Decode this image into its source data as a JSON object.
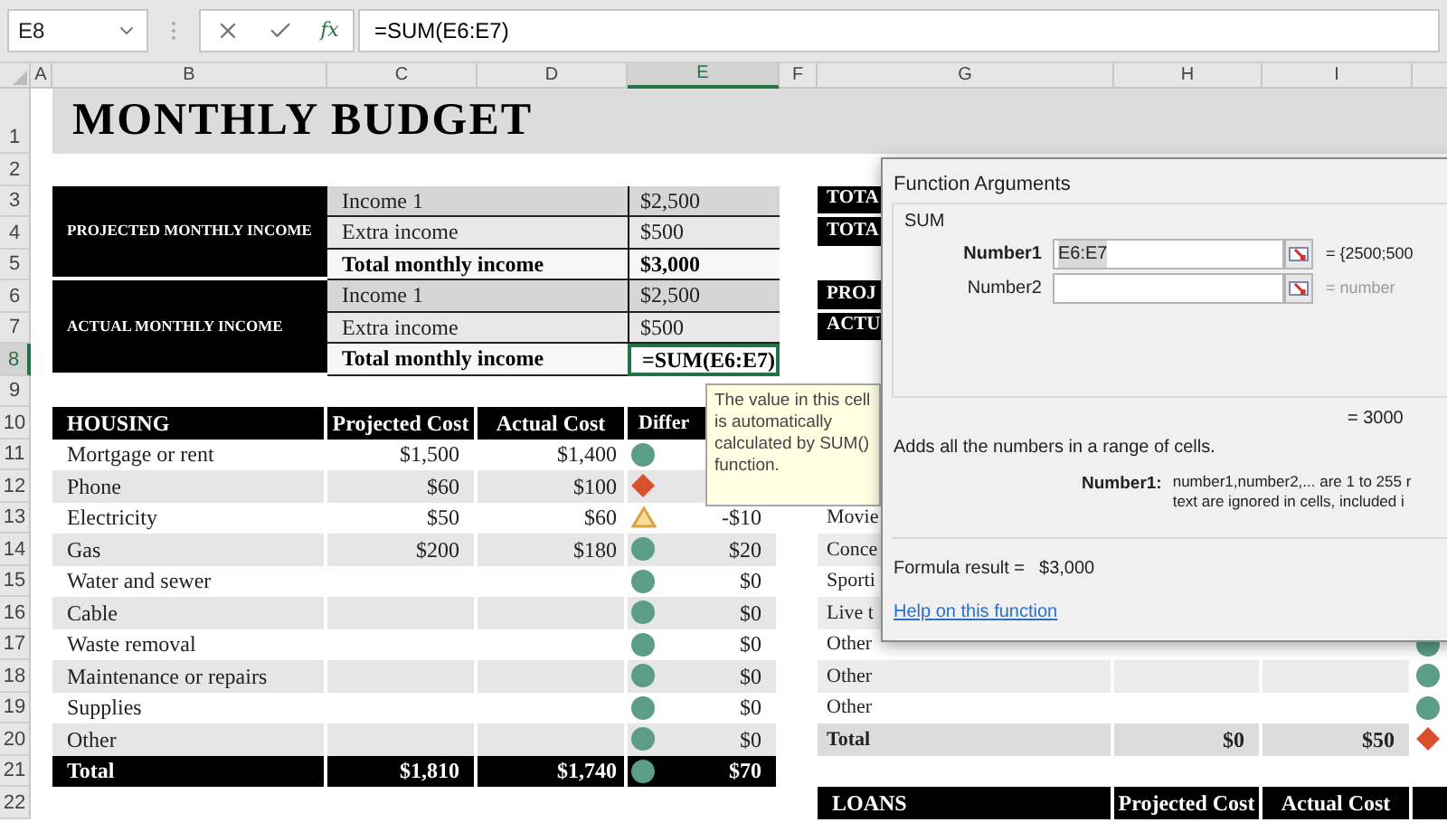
{
  "name_box": {
    "value": "E8"
  },
  "formula_bar": {
    "function_button": "fx",
    "formula": "=SUM(E6:E7)"
  },
  "columns": [
    {
      "label": "A",
      "selected": false
    },
    {
      "label": "B",
      "selected": false
    },
    {
      "label": "C",
      "selected": false
    },
    {
      "label": "D",
      "selected": false
    },
    {
      "label": "E",
      "selected": true
    },
    {
      "label": "F",
      "selected": false
    },
    {
      "label": "G",
      "selected": false
    },
    {
      "label": "H",
      "selected": false
    },
    {
      "label": "I",
      "selected": false
    }
  ],
  "row_numbers": [
    {
      "label": "1",
      "selected": false
    },
    {
      "label": "2",
      "selected": false
    },
    {
      "label": "3",
      "selected": false
    },
    {
      "label": "4",
      "selected": false
    },
    {
      "label": "5",
      "selected": false
    },
    {
      "label": "6",
      "selected": false
    },
    {
      "label": "7",
      "selected": false
    },
    {
      "label": "8",
      "selected": true
    },
    {
      "label": "9",
      "selected": false
    },
    {
      "label": "10",
      "selected": false
    },
    {
      "label": "11",
      "selected": false
    },
    {
      "label": "12",
      "selected": false
    },
    {
      "label": "13",
      "selected": false
    },
    {
      "label": "14",
      "selected": false
    },
    {
      "label": "15",
      "selected": false
    },
    {
      "label": "16",
      "selected": false
    },
    {
      "label": "17",
      "selected": false
    },
    {
      "label": "18",
      "selected": false
    },
    {
      "label": "19",
      "selected": false
    },
    {
      "label": "20",
      "selected": false
    },
    {
      "label": "21",
      "selected": false
    },
    {
      "label": "22",
      "selected": false
    }
  ],
  "title": "MONTHLY BUDGET",
  "income_sections": [
    {
      "label": "PROJECTED MONTHLY INCOME",
      "rows": [
        {
          "label": "Income 1",
          "value": "$2,500",
          "kind": "item",
          "selected": false
        },
        {
          "label": "Extra income",
          "value": "$500",
          "kind": "item",
          "selected": false
        },
        {
          "label": "Total monthly income",
          "value": "$3,000",
          "kind": "total",
          "selected": false
        }
      ]
    },
    {
      "label": "ACTUAL MONTHLY INCOME",
      "rows": [
        {
          "label": "Income 1",
          "value": "$2,500",
          "kind": "item",
          "selected": false
        },
        {
          "label": "Extra income",
          "value": "$500",
          "kind": "item",
          "selected": false
        },
        {
          "label": "Total monthly income",
          "value": "=SUM(E6:E7)",
          "kind": "total",
          "selected": true
        }
      ]
    }
  ],
  "summary_labels": [
    {
      "label": "TOTA"
    },
    {
      "label": "TOTA"
    },
    {
      "label": "PROJ"
    },
    {
      "label": "ACTU"
    }
  ],
  "housing": {
    "columns": [
      "HOUSING",
      "Projected Cost",
      "Actual Cost",
      "Differ"
    ],
    "rows": [
      {
        "label": "Mortgage or rent",
        "projected": "$1,500",
        "actual": "$1,400",
        "kind": "ok"
      },
      {
        "label": "Phone",
        "projected": "$60",
        "actual": "$100",
        "kind": "over"
      },
      {
        "label": "Electricity",
        "projected": "$50",
        "actual": "$60",
        "kind": "warning",
        "difference": "-$10"
      },
      {
        "label": "Gas",
        "projected": "$200",
        "actual": "$180",
        "kind": "ok",
        "difference": "$20"
      },
      {
        "label": "Water and sewer",
        "kind": "ok",
        "difference": "$0"
      },
      {
        "label": "Cable",
        "kind": "ok",
        "difference": "$0"
      },
      {
        "label": "Waste removal",
        "kind": "ok",
        "difference": "$0"
      },
      {
        "label": "Maintenance or repairs",
        "kind": "ok",
        "difference": "$0"
      },
      {
        "label": "Supplies",
        "kind": "ok",
        "difference": "$0"
      },
      {
        "label": "Other",
        "kind": "ok",
        "difference": "$0"
      }
    ],
    "total": {
      "label": "Total",
      "projected": "$1,810",
      "actual": "$1,740",
      "kind": "ok",
      "difference": "$70"
    }
  },
  "entertainment": {
    "rows": [
      {
        "label": "Movie"
      },
      {
        "label": "Conce"
      },
      {
        "label": "Sporti"
      },
      {
        "label": "Live t"
      },
      {
        "label": "Other",
        "kind": "ok"
      },
      {
        "label": "Other",
        "kind": "ok"
      },
      {
        "label": "Other",
        "kind": "ok"
      }
    ],
    "total": {
      "label": "Total",
      "projected": "$0",
      "actual": "$50",
      "kind": "over"
    }
  },
  "loans": {
    "columns": [
      "LOANS",
      "Projected Cost",
      "Actual Cost"
    ]
  },
  "tooltip": "The value in this cell is automatically calculated by SUM() function.",
  "dialog": {
    "title": "Function Arguments",
    "function": "SUM",
    "arguments": [
      {
        "label": "Number1",
        "value": "E6:E7",
        "result": "= {2500;500",
        "bold": true
      },
      {
        "label": "Number2",
        "result": "= number",
        "bold": false
      }
    ],
    "result": "= 3000",
    "description": "Adds all the numbers in a range of cells.",
    "argument_help": {
      "label": "Number1:",
      "lines": [
        "number1,number2,... are 1 to 255 r",
        "text are ignored in cells, included i"
      ]
    },
    "formula_result_label": "Formula result =",
    "formula_result": "$3,000",
    "help_link": "Help on this function"
  }
}
